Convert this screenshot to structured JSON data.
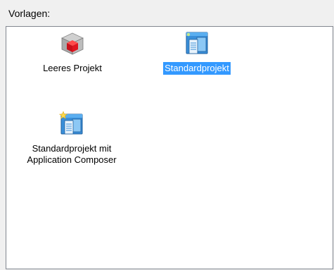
{
  "header": {
    "label": "Vorlagen:"
  },
  "templates": [
    {
      "label": "Leeres Projekt",
      "icon": "red-cube-icon",
      "selected": false
    },
    {
      "label": "Standardprojekt",
      "icon": "standard-project-icon",
      "selected": true
    },
    {
      "label": "Standardprojekt mit Application Composer",
      "line1": "Standardprojekt mit",
      "line2": "Application Composer",
      "icon": "standard-project-composer-icon",
      "selected": false
    }
  ],
  "colors": {
    "selection": "#3399ff",
    "border": "#828790",
    "background": "#f0f0f0"
  }
}
